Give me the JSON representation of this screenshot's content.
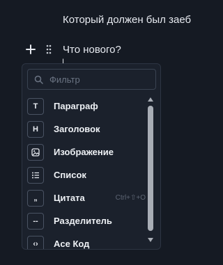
{
  "editor": {
    "previous_line": "Который должен был заеб",
    "current_line": "Что нового?",
    "partial_next_line": "|"
  },
  "icons": {
    "add": "plus-icon",
    "drag": "drag-handle-icon",
    "search": "search-icon",
    "scroll_up": "scroll-up-arrow-icon",
    "scroll_down": "scroll-down-arrow-icon"
  },
  "filter": {
    "placeholder": "Фильтр",
    "value": ""
  },
  "menu": {
    "items": [
      {
        "icon_name": "paragraph-icon",
        "icon_glyph": "T",
        "label": "Параграф",
        "shortcut": ""
      },
      {
        "icon_name": "heading-icon",
        "icon_glyph": "H",
        "label": "Заголовок",
        "shortcut": ""
      },
      {
        "icon_name": "image-icon",
        "icon_glyph": "",
        "label": "Изображение",
        "shortcut": ""
      },
      {
        "icon_name": "list-icon",
        "icon_glyph": "",
        "label": "Список",
        "shortcut": ""
      },
      {
        "icon_name": "quote-icon",
        "icon_glyph": "„",
        "label": "Цитата",
        "shortcut": "Ctrl+⇧+O"
      },
      {
        "icon_name": "divider-icon",
        "icon_glyph": "--",
        "label": "Разделитель",
        "shortcut": ""
      },
      {
        "icon_name": "code-icon",
        "icon_glyph": "‹›",
        "label": "Ace Код",
        "shortcut": ""
      }
    ]
  },
  "colors": {
    "background": "#151a23",
    "popup_background": "#1b212c",
    "border": "#2d3543",
    "text": "#e7eaf0",
    "muted_text": "#6b7483",
    "scroll_thumb": "#a9aeb6"
  }
}
